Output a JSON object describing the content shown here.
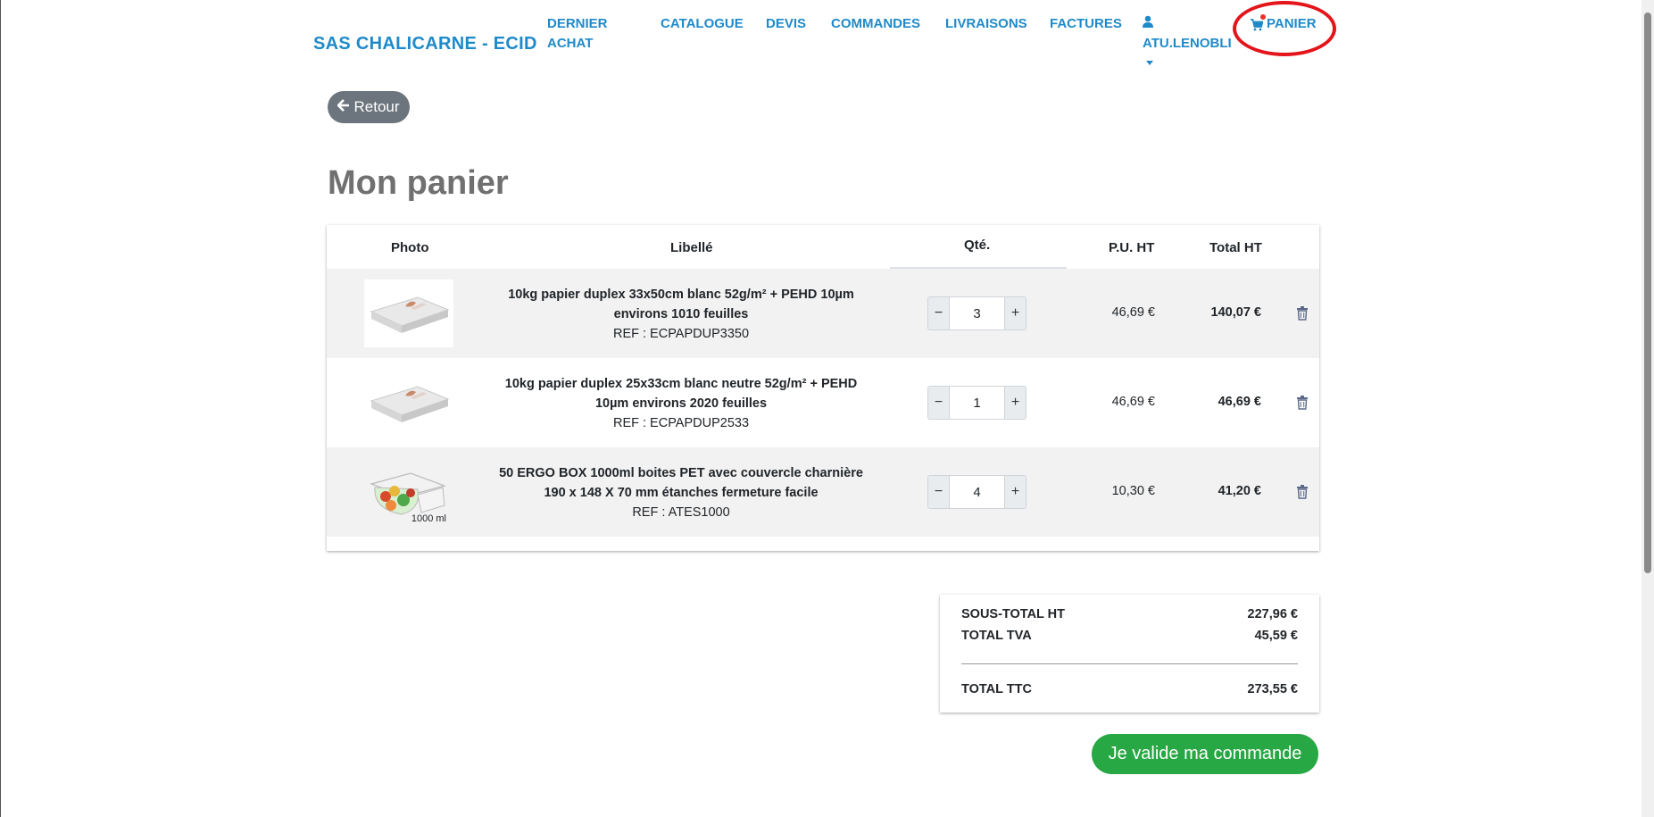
{
  "nav": {
    "brand": "SAS CHALICARNE - ECID",
    "dernier_achat_line1": "DERNIER",
    "dernier_achat_line2": "ACHAT",
    "catalogue": "CATALOGUE",
    "devis": "DEVIS",
    "commandes": "COMMANDES",
    "livraisons": "LIVRAISONS",
    "factures": "FACTURES",
    "user": "ATU.LENOBLI",
    "panier": "PANIER"
  },
  "back_label": "Retour",
  "page_title": "Mon panier",
  "table": {
    "headers": {
      "photo": "Photo",
      "libelle": "Libellé",
      "qte": "Qté.",
      "pu_ht": "P.U. HT",
      "total_ht": "Total HT"
    },
    "rows": [
      {
        "title": "10kg papier duplex 33x50cm blanc 52g/m² + PEHD 10µm environs 1010 feuilles",
        "ref": "REF : ECPAPDUP3350",
        "qty": "3",
        "pu": "46,69 €",
        "total": "140,07 €"
      },
      {
        "title": "10kg papier duplex 25x33cm blanc neutre 52g/m² + PEHD 10µm environs 2020 feuilles",
        "ref": "REF : ECPAPDUP2533",
        "qty": "1",
        "pu": "46,69 €",
        "total": "46,69 €"
      },
      {
        "title": "50 ERGO BOX 1000ml boites PET avec couvercle charnière 190 x 148 X 70 mm étanches fermeture facile",
        "ref": "REF : ATES1000",
        "qty": "4",
        "pu": "10,30 €",
        "total": "41,20 €",
        "photo_caption": "1000 ml"
      }
    ],
    "minus": "−",
    "plus": "+"
  },
  "summary": {
    "sous_total_label": "SOUS-TOTAL HT",
    "sous_total_value": "227,96 €",
    "tva_label": "TOTAL TVA",
    "tva_value": "45,59 €",
    "ttc_label": "TOTAL TTC",
    "ttc_value": "273,55 €"
  },
  "validate_label": "Je valide ma commande",
  "colors": {
    "link": "#1f8ac9",
    "success": "#28a745",
    "highlight_circle": "#e4141b"
  }
}
